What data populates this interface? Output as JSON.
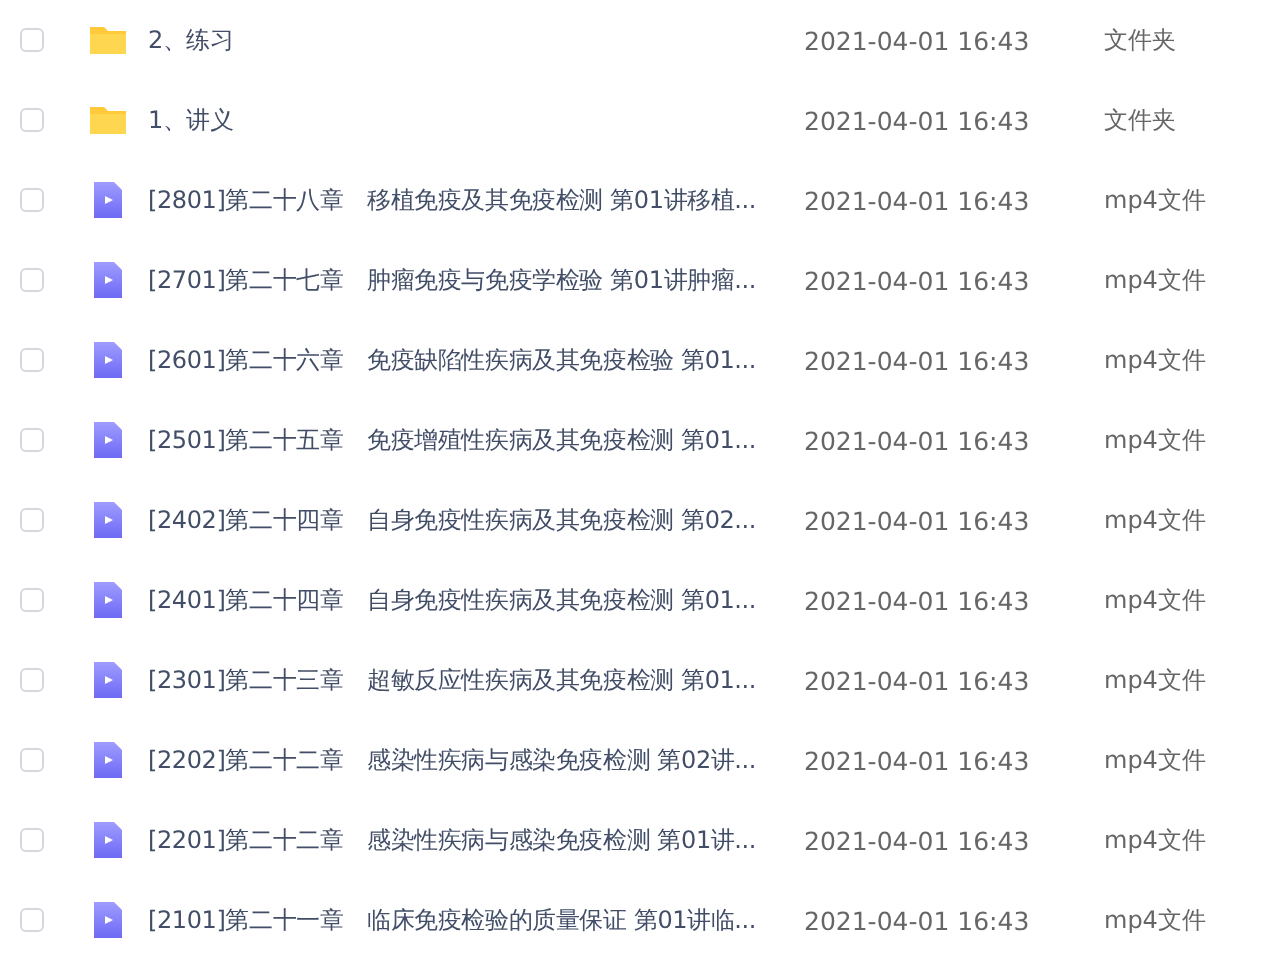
{
  "files": [
    {
      "kind": "folder",
      "selected": false,
      "name": "2、练习",
      "modified": "2021-04-01 16:43",
      "type": "文件夹"
    },
    {
      "kind": "folder",
      "selected": false,
      "name": "1、讲义",
      "modified": "2021-04-01 16:43",
      "type": "文件夹"
    },
    {
      "kind": "video",
      "selected": false,
      "name": "[2801]第二十八章　移植免疫及其免疫检测 第01讲移植...",
      "modified": "2021-04-01 16:43",
      "type": "mp4文件"
    },
    {
      "kind": "video",
      "selected": false,
      "name": "[2701]第二十七章　肿瘤免疫与免疫学检验 第01讲肿瘤...",
      "modified": "2021-04-01 16:43",
      "type": "mp4文件"
    },
    {
      "kind": "video",
      "selected": false,
      "name": "[2601]第二十六章　免疫缺陷性疾病及其免疫检验 第01...",
      "modified": "2021-04-01 16:43",
      "type": "mp4文件"
    },
    {
      "kind": "video",
      "selected": false,
      "name": "[2501]第二十五章　免疫增殖性疾病及其免疫检测 第01...",
      "modified": "2021-04-01 16:43",
      "type": "mp4文件"
    },
    {
      "kind": "video",
      "selected": false,
      "name": "[2402]第二十四章　自身免疫性疾病及其免疫检测 第02...",
      "modified": "2021-04-01 16:43",
      "type": "mp4文件"
    },
    {
      "kind": "video",
      "selected": false,
      "name": "[2401]第二十四章　自身免疫性疾病及其免疫检测 第01...",
      "modified": "2021-04-01 16:43",
      "type": "mp4文件"
    },
    {
      "kind": "video",
      "selected": false,
      "name": "[2301]第二十三章　超敏反应性疾病及其免疫检测 第01...",
      "modified": "2021-04-01 16:43",
      "type": "mp4文件"
    },
    {
      "kind": "video",
      "selected": false,
      "name": "[2202]第二十二章　感染性疾病与感染免疫检测 第02讲...",
      "modified": "2021-04-01 16:43",
      "type": "mp4文件"
    },
    {
      "kind": "video",
      "selected": false,
      "name": "[2201]第二十二章　感染性疾病与感染免疫检测 第01讲...",
      "modified": "2021-04-01 16:43",
      "type": "mp4文件"
    },
    {
      "kind": "video",
      "selected": false,
      "name": "[2101]第二十一章　临床免疫检验的质量保证 第01讲临...",
      "modified": "2021-04-01 16:43",
      "type": "mp4文件"
    }
  ]
}
